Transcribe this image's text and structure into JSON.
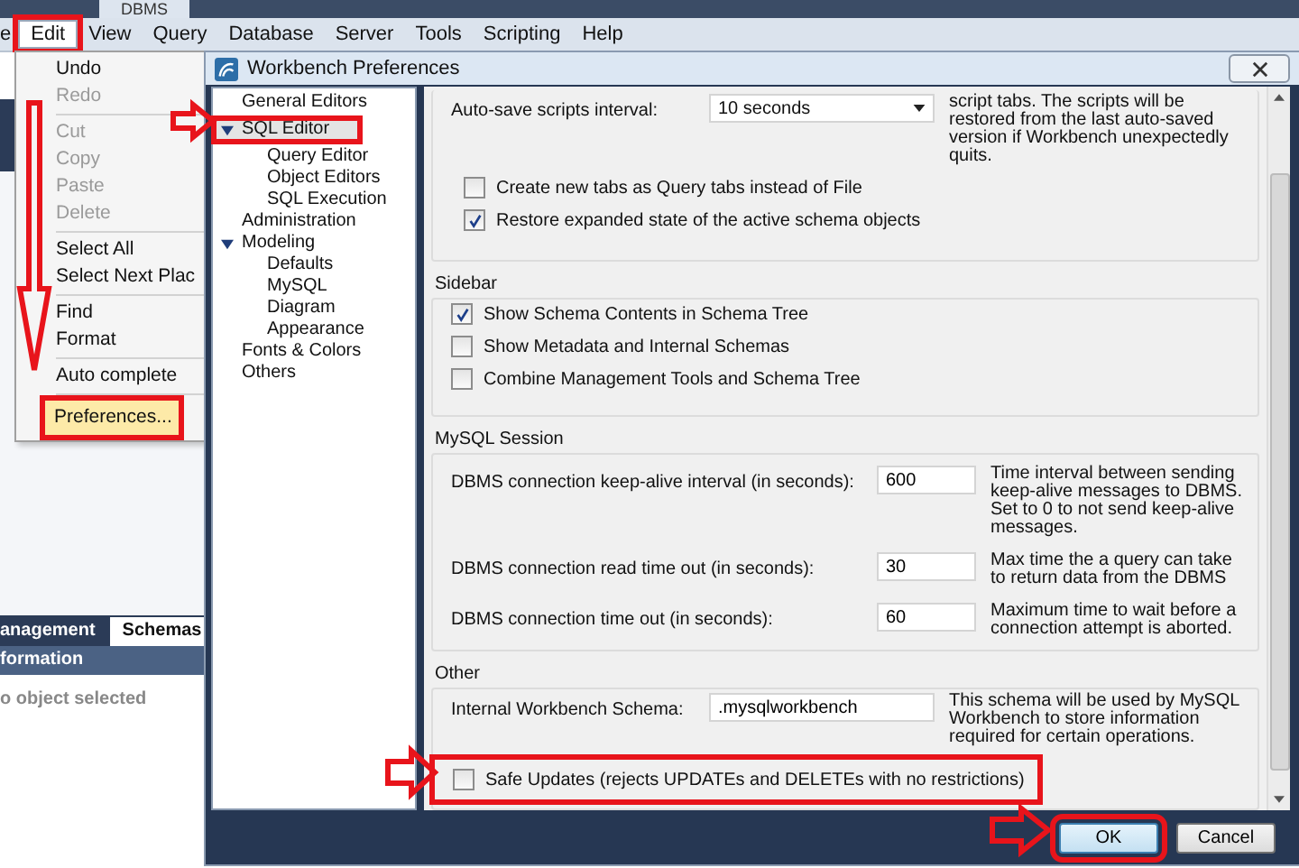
{
  "app": {
    "tab_title": "DBMS",
    "menu": [
      {
        "label": "e",
        "selected": false
      },
      {
        "label": "Edit",
        "selected": true
      },
      {
        "label": "View",
        "selected": false
      },
      {
        "label": "Query",
        "selected": false
      },
      {
        "label": "Database",
        "selected": false
      },
      {
        "label": "Server",
        "selected": false
      },
      {
        "label": "Tools",
        "selected": false
      },
      {
        "label": "Scripting",
        "selected": false
      },
      {
        "label": "Help",
        "selected": false
      }
    ],
    "side_tabs": [
      {
        "label": "anagement",
        "selected": false
      },
      {
        "label": "Schemas",
        "selected": true
      }
    ],
    "info_header": "formation",
    "info_text": "o object selected"
  },
  "edit_menu": [
    [
      {
        "label": "Undo",
        "disabled": false,
        "selected": false
      },
      {
        "label": "Redo",
        "disabled": true,
        "selected": false
      }
    ],
    [
      {
        "label": "Cut",
        "disabled": true,
        "selected": false
      },
      {
        "label": "Copy",
        "disabled": true,
        "selected": false
      },
      {
        "label": "Paste",
        "disabled": true,
        "selected": false
      },
      {
        "label": "Delete",
        "disabled": true,
        "selected": false
      }
    ],
    [
      {
        "label": "Select All",
        "disabled": false,
        "selected": false
      },
      {
        "label": "Select Next Plac",
        "disabled": false,
        "selected": false
      }
    ],
    [
      {
        "label": "Find",
        "disabled": false,
        "selected": false
      },
      {
        "label": "Format",
        "disabled": false,
        "selected": false
      }
    ],
    [
      {
        "label": "Auto complete",
        "disabled": false,
        "selected": false
      }
    ],
    [
      {
        "label": "Preferences...",
        "disabled": false,
        "selected": true
      }
    ]
  ],
  "dialog": {
    "title": "Workbench Preferences",
    "tree": [
      {
        "label": "General Editors",
        "selected": false
      },
      {
        "label": "SQL Editor",
        "selected": true,
        "expanded": true,
        "children": [
          {
            "label": "Query Editor",
            "selected": false
          },
          {
            "label": "Object Editors",
            "selected": false
          },
          {
            "label": "SQL Execution",
            "selected": false
          }
        ]
      },
      {
        "label": "Administration",
        "selected": false
      },
      {
        "label": "Modeling",
        "selected": false,
        "expanded": true,
        "children": [
          {
            "label": "Defaults",
            "selected": false
          },
          {
            "label": "MySQL",
            "selected": false
          },
          {
            "label": "Diagram",
            "selected": false
          },
          {
            "label": "Appearance",
            "selected": false
          }
        ]
      },
      {
        "label": "Fonts & Colors",
        "selected": false
      },
      {
        "label": "Others",
        "selected": false
      }
    ],
    "sections": [
      {
        "rows": [
          {
            "kind": "select",
            "label": "Auto-save scripts interval:",
            "value": "10 seconds",
            "note": "script tabs. The scripts will be restored from the last auto-saved version if Workbench unexpectedly quits."
          },
          {
            "kind": "checkbox",
            "label": "Create new tabs as Query tabs instead of File",
            "checked": false
          },
          {
            "kind": "checkbox",
            "label": "Restore expanded state of the active schema objects",
            "checked": true
          }
        ]
      },
      {
        "title": "Sidebar",
        "rows": [
          {
            "kind": "checkbox",
            "label": "Show Schema Contents in Schema Tree",
            "checked": true
          },
          {
            "kind": "checkbox",
            "label": "Show Metadata and Internal Schemas",
            "checked": false
          },
          {
            "kind": "checkbox",
            "label": "Combine Management Tools and Schema Tree",
            "checked": false
          }
        ]
      },
      {
        "title": "MySQL Session",
        "rows": [
          {
            "kind": "field",
            "label": "DBMS connection keep-alive interval (in seconds):",
            "value": "600",
            "note": "Time interval between sending keep-alive messages to DBMS. Set to 0 to not send keep-alive messages."
          },
          {
            "kind": "field",
            "label": "DBMS connection read time out (in seconds):",
            "value": "30",
            "note": "Max time the a query can take to return data from the DBMS"
          },
          {
            "kind": "field",
            "label": "DBMS connection time out (in seconds):",
            "value": "60",
            "note": "Maximum time to wait before a connection attempt is aborted."
          }
        ]
      },
      {
        "title": "Other",
        "rows": [
          {
            "kind": "field",
            "label": "Internal Workbench Schema:",
            "value": ".mysqlworkbench",
            "note": "This schema will be used by MySQL Workbench to store information required for certain operations."
          },
          {
            "kind": "checkbox",
            "label": "Safe Updates (rejects UPDATEs and DELETEs with no restrictions)",
            "checked": false
          }
        ]
      }
    ],
    "buttons": [
      {
        "label": "OK",
        "kind": "default"
      },
      {
        "label": "Cancel",
        "kind": "normal"
      }
    ]
  }
}
